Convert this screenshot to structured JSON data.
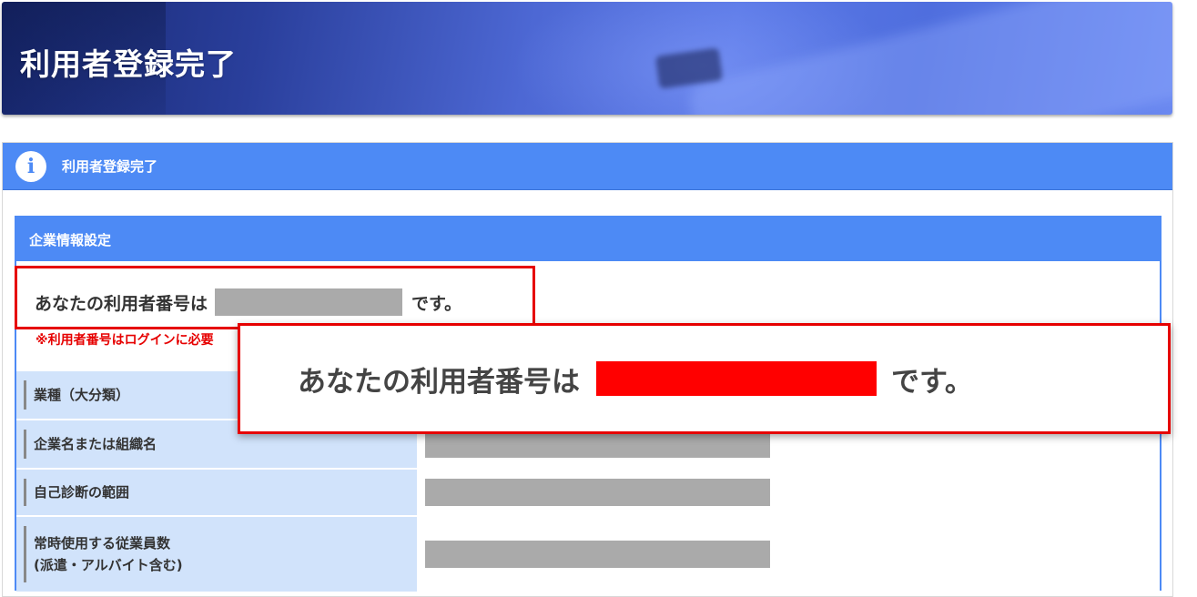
{
  "banner": {
    "title": "利用者登録完了"
  },
  "panel": {
    "title": "利用者登録完了",
    "icon": "info-icon"
  },
  "card": {
    "title": "企業情報設定",
    "user_number_prefix": "あなたの利用者番号は",
    "user_number_suffix": "です。",
    "note": "※利用者番号はログインに必要"
  },
  "table": {
    "rows": [
      {
        "label": "業種（大分類）"
      },
      {
        "label": "企業名または組織名"
      },
      {
        "label": "自己診断の範囲"
      },
      {
        "label_line1": "常時使用する従業員数",
        "label_line2": "(派遣・アルバイト含む)"
      }
    ]
  },
  "callout": {
    "prefix": "あなたの利用者番号は",
    "suffix": "です。"
  },
  "colors": {
    "primary": "#4d8af5",
    "highlight": "#e60000",
    "label_bg": "#d1e3fb",
    "mask": "#aaaaaa"
  }
}
